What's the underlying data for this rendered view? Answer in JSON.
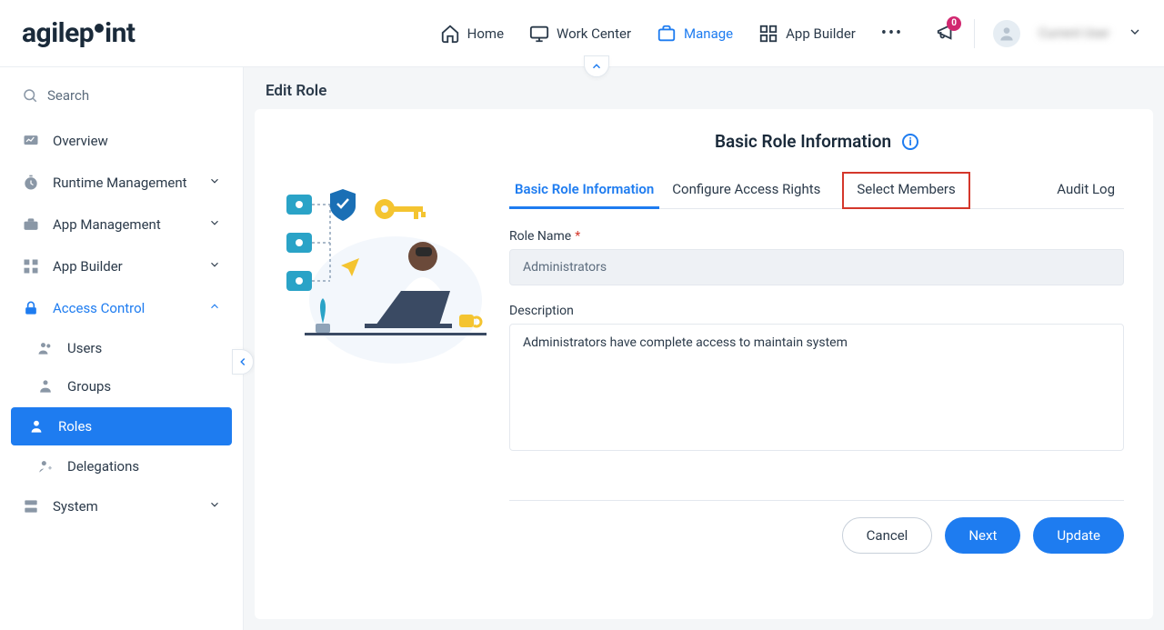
{
  "brand": "agilepoint",
  "topnav": {
    "home": "Home",
    "workcenter": "Work Center",
    "manage": "Manage",
    "appbuilder": "App Builder"
  },
  "notifications": {
    "count": "0"
  },
  "user": {
    "display_name": "Current User"
  },
  "sidebar": {
    "search_placeholder": "Search",
    "items": [
      {
        "label": "Overview"
      },
      {
        "label": "Runtime Management"
      },
      {
        "label": "App Management"
      },
      {
        "label": "App Builder"
      },
      {
        "label": "Access Control"
      },
      {
        "label": "System"
      }
    ],
    "access_control": {
      "users": "Users",
      "groups": "Groups",
      "roles": "Roles",
      "delegations": "Delegations"
    }
  },
  "page": {
    "title": "Edit Role",
    "heading": "Basic Role Information",
    "tabs": {
      "basic": "Basic Role Information",
      "rights": "Configure Access Rights",
      "members": "Select Members",
      "audit": "Audit Log"
    },
    "fields": {
      "role_name_label": "Role Name",
      "role_name_value": "Administrators",
      "description_label": "Description",
      "description_value": "Administrators have complete access to maintain system"
    },
    "buttons": {
      "cancel": "Cancel",
      "next": "Next",
      "update": "Update"
    }
  }
}
